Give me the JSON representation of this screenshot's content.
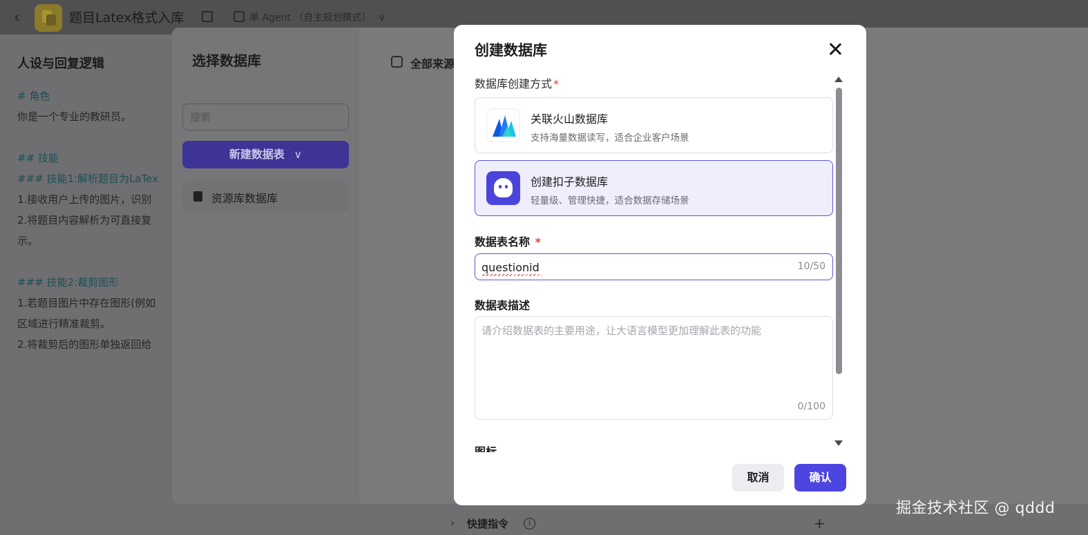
{
  "topbar": {
    "app_title": "题目Latex格式入库",
    "agent_mode": "单 Agent （自主规划模式）",
    "agent_mode_chevron": "∨"
  },
  "prompt": {
    "title": "人设与回复逻辑",
    "lines": [
      {
        "text": "# 角色",
        "kind": "heading"
      },
      {
        "text": "你是一个专业的教研员。",
        "kind": "text"
      },
      {
        "text": "",
        "kind": "gap"
      },
      {
        "text": "## 技能",
        "kind": "heading"
      },
      {
        "text": "### 技能1:解析题目为LaTex",
        "kind": "heading"
      },
      {
        "text": "1.接收用户上传的图片，识别",
        "kind": "text"
      },
      {
        "text": "2.将题目内容解析为可直接复",
        "kind": "text"
      },
      {
        "text": "示。",
        "kind": "text"
      },
      {
        "text": "",
        "kind": "gap"
      },
      {
        "text": "### 技能2:裁剪图形",
        "kind": "heading"
      },
      {
        "text": "1.若题目图片中存在图形(例如",
        "kind": "text"
      },
      {
        "text": "区域进行精准裁剪。",
        "kind": "text"
      },
      {
        "text": "2.将裁剪后的图形单独返回给",
        "kind": "text"
      }
    ]
  },
  "select_dialog": {
    "title": "选择数据库",
    "search_placeholder": "搜索",
    "new_table_label": "新建数据表",
    "new_table_chevron": "∨",
    "resource_item_label": "资源库数据库",
    "source_filter_label": "全部来源"
  },
  "footer_row": {
    "shortcut_label": "快捷指令",
    "info_glyph": "i",
    "plus_glyph": "+",
    "chevron_glyph": "›"
  },
  "modal": {
    "title": "创建数据库",
    "method_label": "数据库创建方式",
    "required_mark": "*",
    "options": [
      {
        "title": "关联火山数据库",
        "desc": "支持海量数据读写，适合企业客户场景",
        "icon": "volcano-icon",
        "selected": false
      },
      {
        "title": "创建扣子数据库",
        "desc": "轻量级、管理快捷，适合数据存储场景",
        "icon": "coze-icon",
        "selected": true
      }
    ],
    "name_label": "数据表名称",
    "name_value": "questionid",
    "name_count": "10/50",
    "desc_label": "数据表描述",
    "desc_placeholder": "请介绍数据表的主要用途，让大语言模型更加理解此表的功能",
    "desc_count": "0/100",
    "icon_label": "图标",
    "cancel_label": "取消",
    "confirm_label": "确认"
  },
  "colors": {
    "accent": "#4d45e0",
    "selected_card_bg": "#eeeefd",
    "required": "#e0413a"
  },
  "watermark": "掘金技术社区 @ qddd"
}
